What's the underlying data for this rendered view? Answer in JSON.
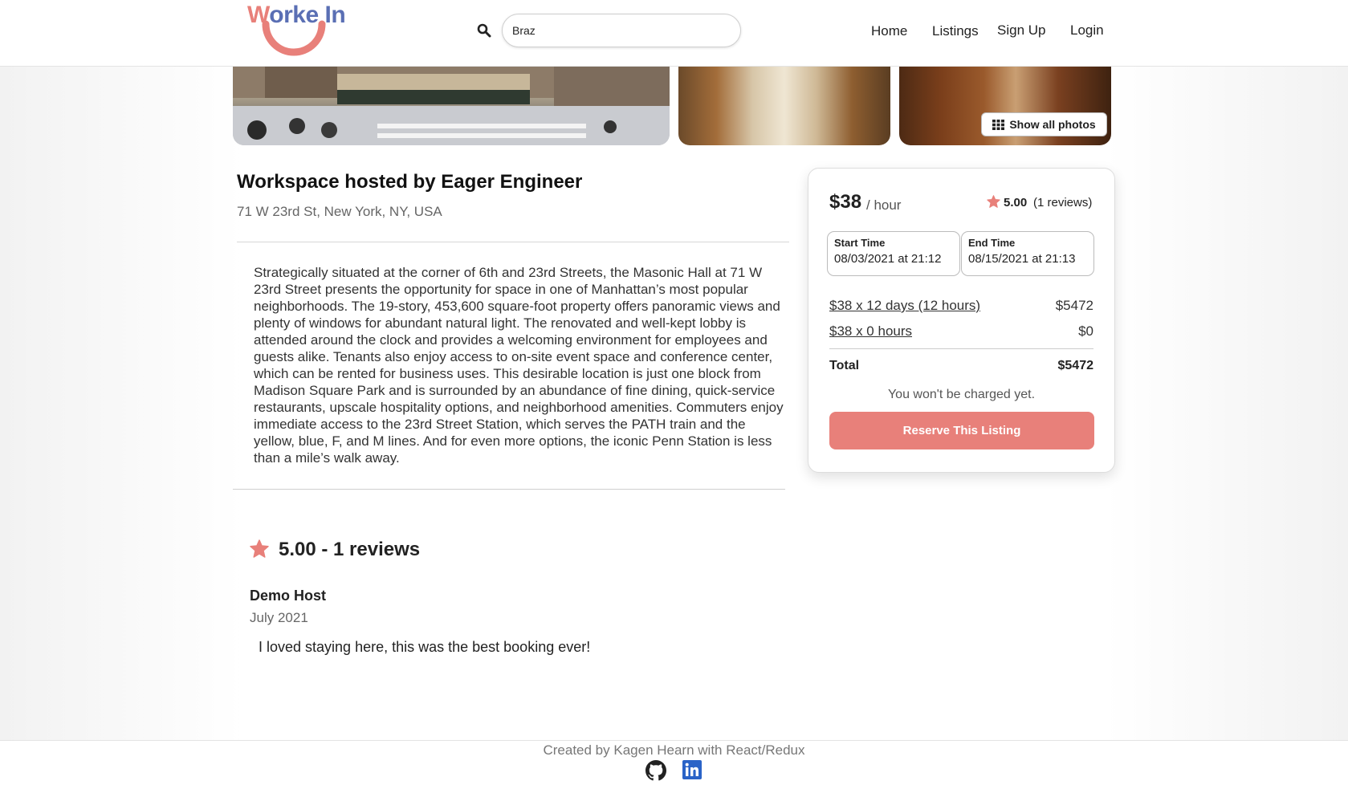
{
  "header": {
    "logo": {
      "w": "W",
      "rest": "orke In"
    },
    "search": {
      "value": "Braz",
      "placeholder": ""
    },
    "nav": {
      "home": "Home",
      "listings": "Listings",
      "signup": "Sign Up",
      "login": "Login"
    }
  },
  "gallery": {
    "show_all": "Show all photos"
  },
  "listing": {
    "title": "Workspace hosted by Eager Engineer",
    "address": "71 W 23rd St, New York, NY, USA",
    "description": "Strategically situated at the corner of 6th and 23rd Streets, the Masonic Hall at 71 W 23rd Street presents the opportunity for space in one of Manhattan’s most popular neighborhoods. The 19-story, 453,600 square-foot property offers panoramic views and plenty of windows for abundant natural light. The renovated and well-kept lobby is attended around the clock and provides a welcoming environment for employees and guests alike. Tenants also enjoy access to on-site event space and conference center, which can be rented for business uses. This desirable location is just one block from Madison Square Park and is surrounded by an abundance of fine dining, quick-service restaurants, upscale hospitality options, and neighborhood amenities. Commuters enjoy immediate access to the 23rd Street Station, which serves the PATH train and the yellow, blue, F, and M lines. And for even more options, the iconic Penn Station is less than a mile’s walk away."
  },
  "booking": {
    "price": "$38",
    "per": "/ hour",
    "rating": "5.00",
    "reviews_count": "(1 reviews)",
    "start_label": "Start Time",
    "start_value": "08/03/2021 at 21:12",
    "end_label": "End Time",
    "end_value": "08/15/2021 at 21:13",
    "line_days": "$38 x 12 days (12 hours)",
    "line_days_value": "$5472",
    "line_hours": "$38 x 0 hours",
    "line_hours_value": "$0",
    "total_label": "Total",
    "total_value": "$5472",
    "note": "You won't be charged yet.",
    "reserve": "Reserve This Listing"
  },
  "reviews": {
    "summary": "5.00 - 1 reviews",
    "items": [
      {
        "name": "Demo Host",
        "date": "July 2021",
        "text": "I loved staying here, this was the best booking ever!"
      }
    ]
  },
  "footer": {
    "credit": "Created by Kagen Hearn with React/Redux"
  },
  "colors": {
    "accent": "#e8807a",
    "logo_blue": "#5a6fb4"
  },
  "icons": [
    "search-icon",
    "grid-icon",
    "star-icon",
    "github-icon",
    "linkedin-icon"
  ]
}
